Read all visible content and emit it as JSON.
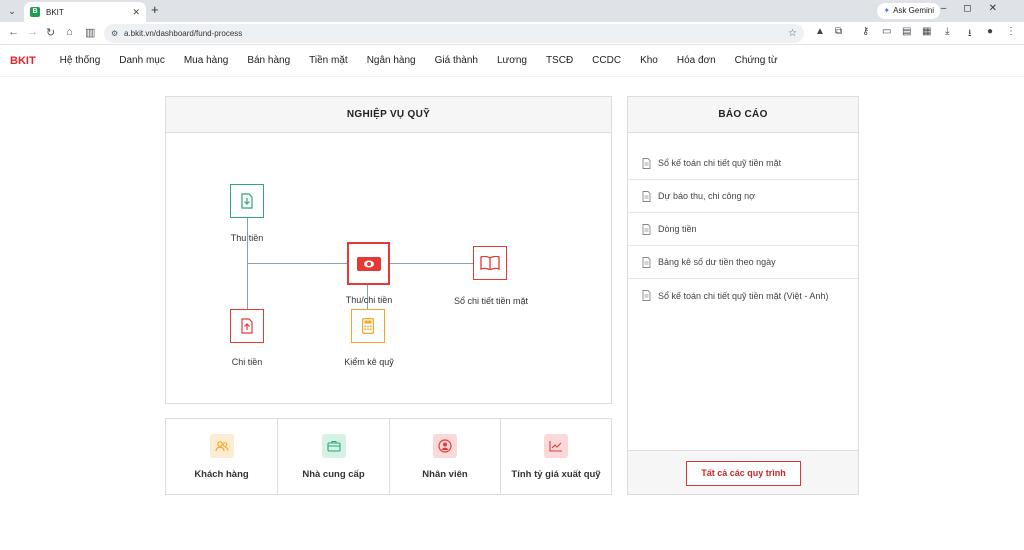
{
  "browser": {
    "tab_title": "BKIT",
    "favicon_letter": "B",
    "url": "a.bkit.vn/dashboard/fund-process",
    "ask_gemini": "Ask Gemini"
  },
  "app": {
    "logo": "BKIT",
    "menu": [
      "Hệ thống",
      "Danh mục",
      "Mua hàng",
      "Bán hàng",
      "Tiền mặt",
      "Ngân hàng",
      "Giá thành",
      "Lương",
      "TSCĐ",
      "CCDC",
      "Kho",
      "Hóa đơn",
      "Chứng từ"
    ]
  },
  "process": {
    "title": "NGHIỆP VỤ QUỸ",
    "nodes": {
      "thu_tien": "Thu tiền",
      "chi_tien": "Chi tiền",
      "thu_chi_tien": "Thu/chi tiền",
      "kiem_ke_quy": "Kiểm kê quỹ",
      "so_chi_tiet_tien_mat": "Sổ chi tiết tiền mặt"
    },
    "colors": {
      "green": "#2aa876",
      "red": "#e53935",
      "orange": "#f5a623",
      "line": "#8aa0b8"
    }
  },
  "reports": {
    "title": "BÁO CÁO",
    "items": [
      "Sổ kế toán chi tiết quỹ tiền mặt",
      "Dự báo thu, chi công nợ",
      "Dòng tiền",
      "Bảng kê số dư tiền theo ngày",
      "Sổ kế toán chi tiết quỹ tiền mặt (Việt - Anh)"
    ],
    "all_button": "Tất cả các quy trình"
  },
  "quick_links": [
    {
      "label": "Khách hàng",
      "icon": "users-icon",
      "color": "#f5a623"
    },
    {
      "label": "Nhà cung cấp",
      "icon": "briefcase-icon",
      "color": "#2aa876"
    },
    {
      "label": "Nhân viên",
      "icon": "user-circle-icon",
      "color": "#e53935"
    },
    {
      "label": "Tính tỷ giá xuất quỹ",
      "icon": "trend-chart-icon",
      "color": "#e53935"
    }
  ]
}
